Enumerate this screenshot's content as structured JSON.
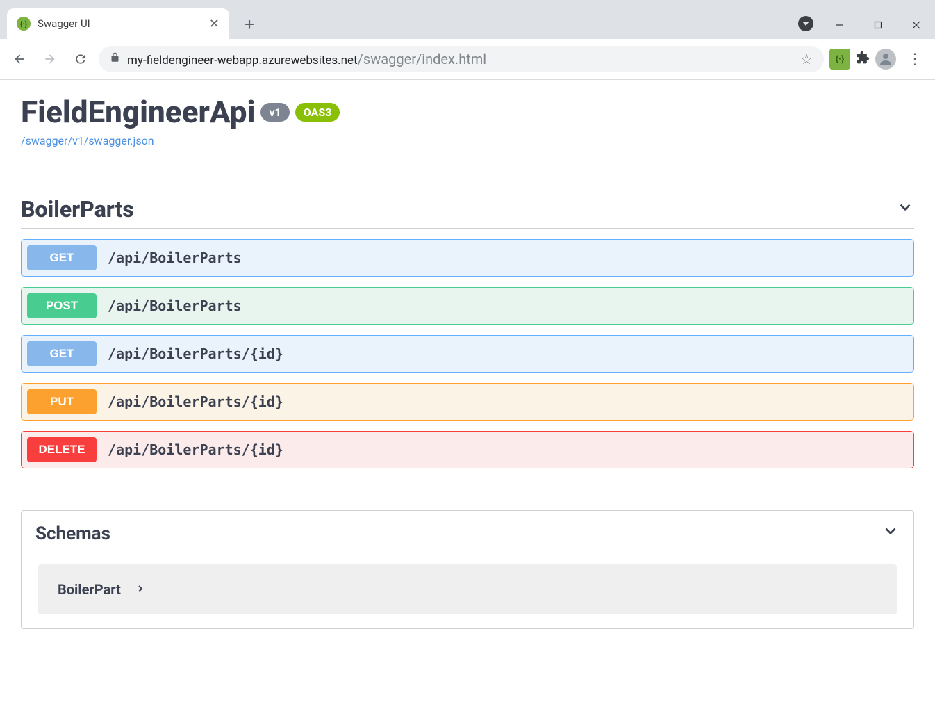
{
  "browser": {
    "tab_title": "Swagger UI",
    "url_host": "my-fieldengineer-webapp.azurewebsites.net",
    "url_path": "/swagger/index.html"
  },
  "api": {
    "title": "FieldEngineerApi",
    "version_badge": "v1",
    "oas_badge": "OAS3",
    "spec_link": "/swagger/v1/swagger.json"
  },
  "section": {
    "title": "BoilerParts",
    "ops": [
      {
        "method": "GET",
        "cls": "get",
        "path": "/api/BoilerParts"
      },
      {
        "method": "POST",
        "cls": "post",
        "path": "/api/BoilerParts"
      },
      {
        "method": "GET",
        "cls": "get",
        "path": "/api/BoilerParts/{id}"
      },
      {
        "method": "PUT",
        "cls": "put",
        "path": "/api/BoilerParts/{id}"
      },
      {
        "method": "DELETE",
        "cls": "delete",
        "path": "/api/BoilerParts/{id}"
      }
    ]
  },
  "schemas": {
    "title": "Schemas",
    "items": [
      "BoilerPart"
    ]
  }
}
